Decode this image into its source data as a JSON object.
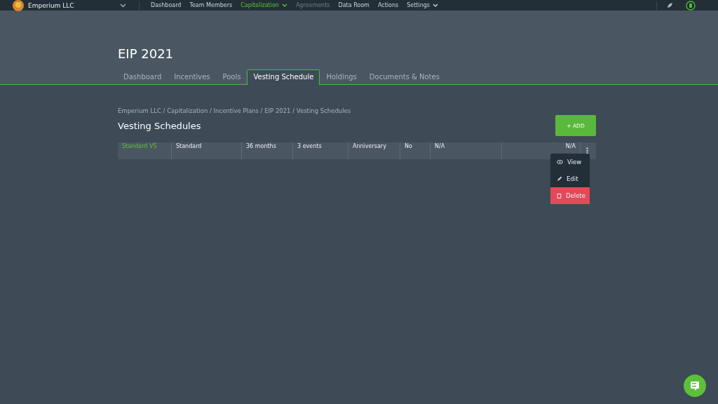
{
  "topbar": {
    "company": "Emperium LLC",
    "nav": [
      {
        "label": "Dashboard",
        "selected": false,
        "disabled": false,
        "dropdown": false
      },
      {
        "label": "Team Members",
        "selected": false,
        "disabled": false,
        "dropdown": false
      },
      {
        "label": "Capitalization",
        "selected": true,
        "disabled": false,
        "dropdown": true
      },
      {
        "label": "Agreements",
        "selected": false,
        "disabled": true,
        "dropdown": false
      },
      {
        "label": "Data Room",
        "selected": false,
        "disabled": false,
        "dropdown": false
      },
      {
        "label": "Actions",
        "selected": false,
        "disabled": false,
        "dropdown": false
      },
      {
        "label": "Settings",
        "selected": false,
        "disabled": false,
        "dropdown": true
      }
    ]
  },
  "page_title": "EIP 2021",
  "tabs": [
    {
      "label": "Dashboard",
      "selected": false
    },
    {
      "label": "Incentives",
      "selected": false
    },
    {
      "label": "Pools",
      "selected": false
    },
    {
      "label": "Vesting Schedule",
      "selected": true
    },
    {
      "label": "Holdings",
      "selected": false
    },
    {
      "label": "Documents & Notes",
      "selected": false
    }
  ],
  "breadcrumb": "Emperium LLC / Capitalization / Incentive Plans / EIP 2021 / Vesting Schedules",
  "section_title": "Vesting Schedules",
  "add_button": "+ ADD",
  "table": {
    "rows": [
      {
        "cells": [
          "Standard VS",
          "Standard",
          "36 months",
          "3 events",
          "Anniversary",
          "No",
          "N/A",
          "N/A"
        ]
      }
    ]
  },
  "row_menu": [
    {
      "label": "View",
      "kind": "view",
      "selected": false
    },
    {
      "label": "Edit",
      "kind": "edit",
      "selected": false
    },
    {
      "label": "Delete",
      "kind": "delete",
      "selected": true
    }
  ]
}
